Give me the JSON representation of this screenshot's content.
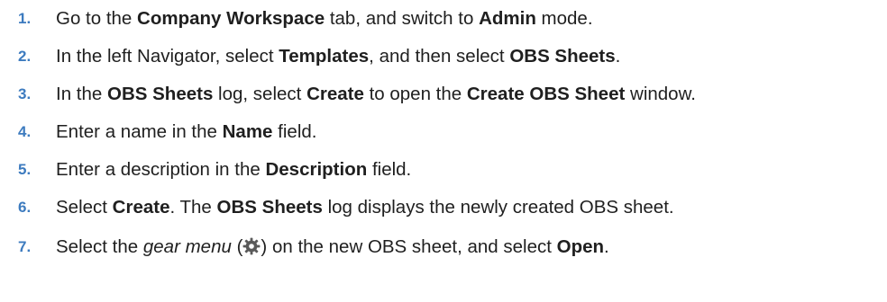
{
  "steps": [
    {
      "number": "1.",
      "parts": [
        {
          "t": "Go to the "
        },
        {
          "t": "Company Workspace",
          "b": true
        },
        {
          "t": " tab, and switch to "
        },
        {
          "t": "Admin",
          "b": true
        },
        {
          "t": " mode."
        }
      ]
    },
    {
      "number": "2.",
      "parts": [
        {
          "t": "In the left Navigator, select "
        },
        {
          "t": "Templates",
          "b": true
        },
        {
          "t": ", and then select "
        },
        {
          "t": "OBS Sheets",
          "b": true
        },
        {
          "t": "."
        }
      ]
    },
    {
      "number": "3.",
      "parts": [
        {
          "t": "In the "
        },
        {
          "t": "OBS Sheets",
          "b": true
        },
        {
          "t": " log, select "
        },
        {
          "t": "Create",
          "b": true
        },
        {
          "t": " to open the "
        },
        {
          "t": "Create OBS Sheet",
          "b": true
        },
        {
          "t": " window."
        }
      ]
    },
    {
      "number": "4.",
      "parts": [
        {
          "t": "Enter a name in the "
        },
        {
          "t": "Name",
          "b": true
        },
        {
          "t": " field."
        }
      ]
    },
    {
      "number": "5.",
      "parts": [
        {
          "t": "Enter a description in the "
        },
        {
          "t": "Description",
          "b": true
        },
        {
          "t": " field."
        }
      ]
    },
    {
      "number": "6.",
      "parts": [
        {
          "t": "Select "
        },
        {
          "t": "Create",
          "b": true
        },
        {
          "t": ". The "
        },
        {
          "t": "OBS Sheets",
          "b": true
        },
        {
          "t": " log displays the newly created OBS sheet."
        }
      ]
    },
    {
      "number": "7.",
      "parts": [
        {
          "t": "Select the "
        },
        {
          "t": "gear menu",
          "i": true
        },
        {
          "t": " ("
        },
        {
          "icon": "gear-icon"
        },
        {
          "t": ") on the new OBS sheet, and select "
        },
        {
          "t": "Open",
          "b": true
        },
        {
          "t": "."
        }
      ]
    }
  ],
  "colors": {
    "step_number": "#3d7bbf",
    "text": "#1f1f1f",
    "gear_icon": "#5a5a5a"
  }
}
